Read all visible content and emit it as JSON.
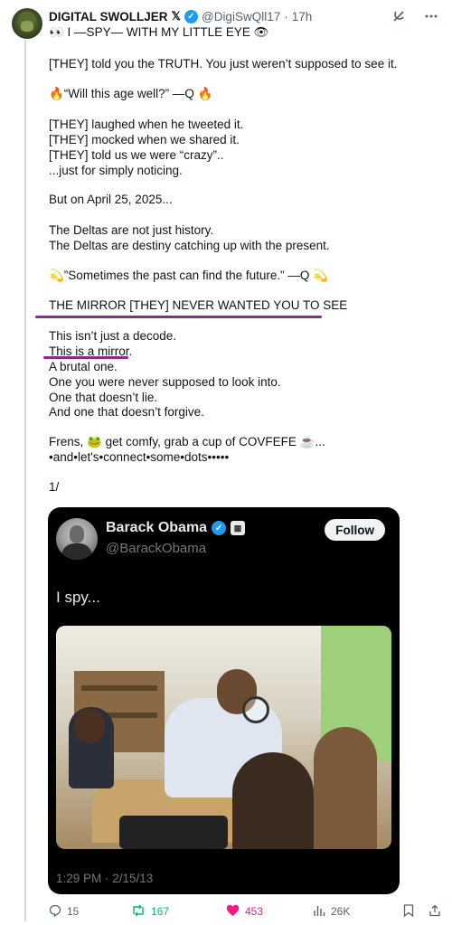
{
  "header": {
    "display_name": "DIGITAL SWOLLJER",
    "x_mark": "𝕏",
    "handle": "@DigiSwQll17",
    "separator": "·",
    "time": "17h"
  },
  "post": {
    "line_01": "👀 I —SPY— WITH MY LITTLE EYE 👁",
    "line_02": "[THEY] told you the TRUTH. You just weren’t supposed to see it.",
    "line_03": "🔥“Will this age well?” —Q 🔥",
    "line_04": "[THEY] laughed when he tweeted it.",
    "line_05": "[THEY] mocked when we shared it.",
    "line_06": "[THEY] told us we were “crazy”..",
    "line_07": "...just for simply noticing.",
    "line_08": "But on April 25, 2025...",
    "line_09": "The Deltas are not just history.",
    "line_10": "The Deltas are destiny catching up with the present.",
    "line_11": "💫”Sometimes the past can find the future.” —Q 💫",
    "line_12": "THE MIRROR [THEY] NEVER WANTED YOU TO SEE",
    "line_13": "This isn’t just a decode.",
    "line_14": "This is a mirror.",
    "line_15": "A brutal one.",
    "line_16": "One you were never supposed to look into.",
    "line_17": "One that doesn’t lie.",
    "line_18": "And one that doesn’t forgive.",
    "line_19": "Frens, 🐸 get comfy, grab a cup of COVFEFE ☕...",
    "line_20": "•and•let's•connect•some•dots•••••",
    "line_21": "1/"
  },
  "quoted": {
    "name": "Barack Obama",
    "handle": "@BarackObama",
    "follow_label": "Follow",
    "text": "I spy...",
    "timestamp": "1:29 PM · 2/15/13"
  },
  "actions": {
    "replies": "15",
    "reposts": "167",
    "likes": "453",
    "views": "26K"
  },
  "colors": {
    "underline": "#8e2a8b",
    "verified": "#1d9bf0",
    "repost": "#00ba7c",
    "like": "#f91880"
  },
  "icons": [
    "avatar",
    "verified-badge-icon",
    "grok-icon",
    "more-icon",
    "reply-icon",
    "repost-icon",
    "heart-icon",
    "views-icon",
    "bookmark-icon",
    "share-icon"
  ]
}
